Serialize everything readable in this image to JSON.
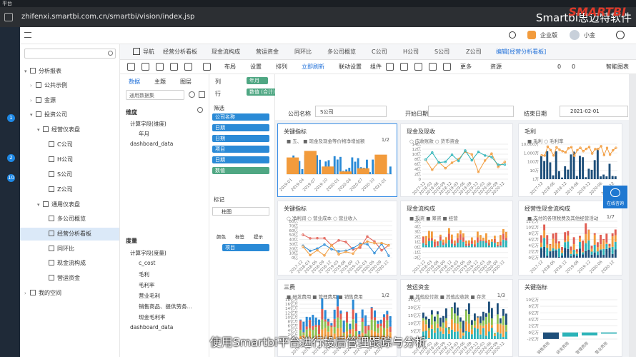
{
  "window": {
    "title": "平台",
    "url": "zhifenxi.smartbi.com.cn/smartbi/vision/index.jsp",
    "brand_red": "SMARTBI",
    "brand_white": "Smartbi思迈特软件"
  },
  "header": {
    "enterprise": "企业版",
    "user": "小金",
    "help": "帮助"
  },
  "sidebar": {
    "root": "分析报表",
    "items": [
      "公共示例",
      "金源",
      "投资公司",
      "经营仪表盘",
      "C公司",
      "H公司",
      "S公司",
      "Z公司",
      "通用仪表盘",
      "多公司概览",
      "经营分析看板",
      "同环比",
      "现金流构成",
      "营运资金",
      "我的空间"
    ]
  },
  "rail": {
    "badges": [
      "1",
      "2",
      "10"
    ]
  },
  "tabs": [
    "导航",
    "经营分析看板",
    "现金流构成",
    "营运资金",
    "同环比",
    "多公司概览",
    "C公司",
    "H公司",
    "S公司",
    "Z公司",
    "编辑[经营分析看板]"
  ],
  "toolbar": {
    "layout": "布局",
    "settings": "设置",
    "arrange": "排列",
    "refresh": "立即刷新",
    "linkage": "联动设置",
    "component": "组件",
    "more": "更多",
    "resource": "资源",
    "comments": "0",
    "likes": "0",
    "smart": "智能图表"
  },
  "datapanel": {
    "tabs": [
      "数据",
      "主题",
      "图层"
    ],
    "dataset_placeholder": "通用数据集",
    "dims_header": "维度",
    "dims_folder": "计算字段(维度)",
    "dims": [
      "年月",
      "dashboard_data"
    ],
    "measures_header": "度量",
    "measures_folder": "计算字段(度量)",
    "measures": [
      "c_cost",
      "毛利",
      "毛利率",
      "营业毛利",
      "销售商品、提供劳务...",
      "现金毛利率",
      "dashboard_data"
    ]
  },
  "fieldpanel": {
    "col_label": "列",
    "row_label": "行",
    "col_value": "年月",
    "row_value": "数值 (合计)",
    "filter_label": "筛选",
    "filters": [
      "公司名称",
      "日期",
      "日期",
      "项目",
      "日期",
      "数值"
    ],
    "marks_label": "标记",
    "chart_type": "柱图",
    "mark_btns": [
      "颜色",
      "标签",
      "提示"
    ],
    "color_field": "项目"
  },
  "filters": {
    "company_label": "公司名称",
    "company_value": "S公司",
    "start_label": "开始日期",
    "start_value": "",
    "end_label": "结束日期",
    "end_value": "2021-02-01"
  },
  "cards": [
    {
      "title": "关键指标",
      "legend": "■ 五、 ■ 现金及现金等价物净增加额",
      "pager": "1/2"
    },
    {
      "title": "现金及现收",
      "legend": "○ 应收账款   ○ 货币资金",
      "pager": ""
    },
    {
      "title": "毛利",
      "legend": "■ 毛利   ○ 毛利率",
      "pager": ""
    },
    {
      "title": "关键指标",
      "legend": "○ 净利润  ○ 营业成本  ○ 营业收入",
      "pager": ""
    },
    {
      "title": "现金流构成",
      "legend": "■ 投资  ■ 筹资  ■ 经营",
      "pager": ""
    },
    {
      "title": "经营性现金流构成",
      "legend": "■ 支付的各项税费及其他经营活动",
      "pager": "1/7"
    },
    {
      "title": "三费",
      "legend": "■ 研发费用  ■ 管理费用  ■ 销售费用",
      "pager": "1/2"
    },
    {
      "title": "营运资金",
      "legend": "■ 其他应付款  ■ 其他应收款  ■ 存货",
      "pager": "1/3"
    },
    {
      "title": "关键指标",
      "legend": "",
      "pager": ""
    }
  ],
  "axis_labels": {
    "months_a": [
      "2019-01",
      "2019-04",
      "2019-07",
      "2019-10",
      "2020-01",
      "2020-04",
      "2020-07",
      "2020-10",
      "2021-01"
    ],
    "months_b": [
      "2017-12",
      "2018-03",
      "2018-06",
      "2018-09",
      "2018-12",
      "2019-03",
      "2019-06",
      "2019-09",
      "2019-12",
      "2020-03",
      "2020-06",
      "2020-09",
      "2020-12"
    ],
    "y_b": [
      "14亿",
      "12亿",
      "10亿",
      "8亿",
      "6亿",
      "4亿",
      "2亿",
      "0"
    ],
    "y_c": [
      "10,000万",
      "1,000万",
      "100万",
      "10万",
      "1万"
    ],
    "y_d": [
      "80亿",
      "70亿",
      "60亿",
      "50亿",
      "40亿",
      "30亿",
      "20亿",
      "10亿",
      "0亿"
    ],
    "y_e": [
      "5亿",
      "4亿",
      "3亿",
      "2亿",
      "1亿",
      "0亿",
      "-1亿",
      "-2亿"
    ],
    "y_f": [
      "12亿万",
      "10亿万",
      "8亿万",
      "6亿万",
      "4亿万",
      "2亿万",
      "0亿万"
    ],
    "y_g": [
      "18亿万",
      "16亿万",
      "14亿万",
      "12亿万",
      "10亿万",
      "8亿万",
      "6亿万",
      "4亿万",
      "2亿万",
      "0亿万"
    ],
    "y_h": [
      "25亿万",
      "20亿万",
      "15亿万",
      "10亿万",
      "5亿万",
      "0亿万"
    ],
    "y_i": [
      "10亿万",
      "8亿万",
      "6亿万",
      "4亿万",
      "2亿万",
      "0亿万",
      "-2亿万"
    ],
    "cats_i": [
      "销售费用",
      "研发费用",
      "管理费用",
      "营业费用"
    ]
  },
  "float": {
    "consult": "在线咨询"
  },
  "subtitle": "使用Smartbi平台进行投后管理跟踪与分析",
  "colors": {
    "accent": "#2a8ad6",
    "teal": "#2bb3b8",
    "orange": "#f29b3c",
    "green": "#8cc152",
    "red": "#e15d52",
    "navy": "#1e4f7a"
  }
}
